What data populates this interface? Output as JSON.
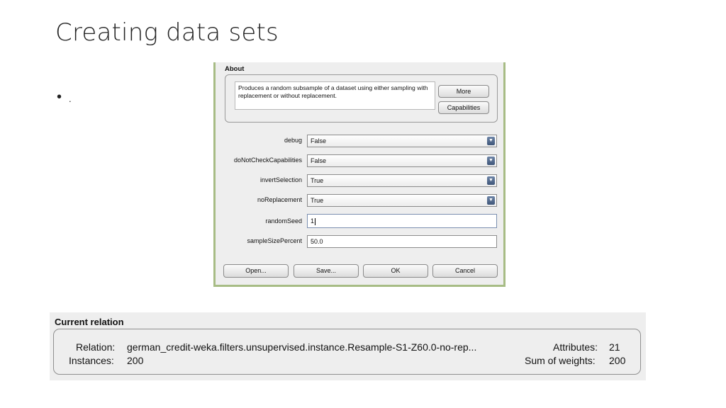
{
  "slide": {
    "title": "Creating data sets",
    "bullet_text": "."
  },
  "dialog": {
    "about_title": "About",
    "about_text": "Produces a random subsample of a dataset using either sampling with replacement or without replacement.",
    "more_label": "More",
    "capabilities_label": "Capabilities",
    "params": [
      {
        "label": "debug",
        "value": "False",
        "type": "select"
      },
      {
        "label": "doNotCheckCapabilities",
        "value": "False",
        "type": "select"
      },
      {
        "label": "invertSelection",
        "value": "True",
        "type": "select"
      },
      {
        "label": "noReplacement",
        "value": "True",
        "type": "select"
      },
      {
        "label": "randomSeed",
        "value": "1",
        "type": "text"
      },
      {
        "label": "sampleSizePercent",
        "value": "50.0",
        "type": "text"
      }
    ],
    "buttons": {
      "open": "Open...",
      "save": "Save...",
      "ok": "OK",
      "cancel": "Cancel"
    },
    "accent_color": "#a7bc85"
  },
  "relation": {
    "title": "Current relation",
    "relation_label": "Relation:",
    "relation_value": "german_credit-weka.filters.unsupervised.instance.Resample-S1-Z60.0-no-rep...",
    "instances_label": "Instances:",
    "instances_value": "200",
    "attributes_label": "Attributes:",
    "attributes_value": "21",
    "weights_label": "Sum of weights:",
    "weights_value": "200"
  },
  "icons": {
    "dropdown": "chevron-down-icon"
  }
}
